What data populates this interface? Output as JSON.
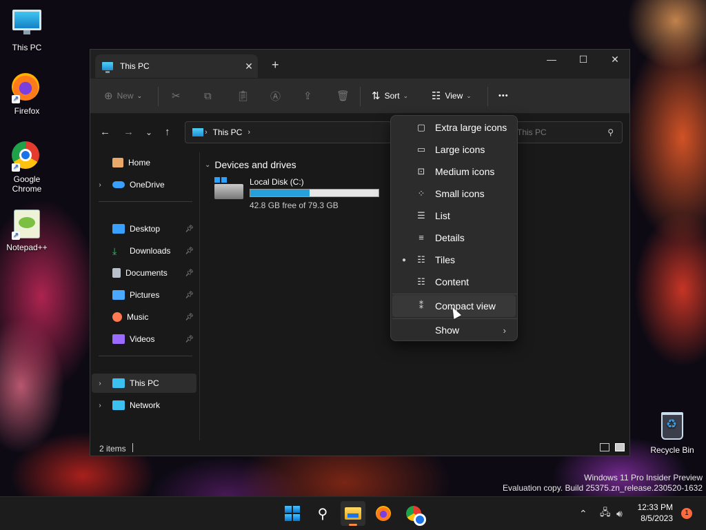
{
  "desktop": {
    "icons": [
      {
        "label": "This PC"
      },
      {
        "label": "Firefox"
      },
      {
        "label": "Google Chrome"
      },
      {
        "label": "Notepad++"
      },
      {
        "label": "Recycle Bin"
      }
    ]
  },
  "window": {
    "tab_title": "This PC",
    "new_tab_glyph": "+",
    "caption": {
      "minimize": "—",
      "maximize": "☐",
      "close": "✕"
    }
  },
  "toolbar": {
    "new_label": "New",
    "sort_label": "Sort",
    "view_label": "View",
    "more_glyph": "•••"
  },
  "address": {
    "crumb": "This PC",
    "search_placeholder": "This PC"
  },
  "sidebar": {
    "items": [
      {
        "label": "Home",
        "icon": "home-icon",
        "color": "#e8a86a"
      },
      {
        "label": "OneDrive",
        "icon": "cloud-icon",
        "color": "#3aa0ff"
      },
      {
        "label": "Desktop",
        "icon": "desktop-folder-icon",
        "color": "#3aa0ff"
      },
      {
        "label": "Downloads",
        "icon": "download-icon",
        "color": "#3cc36b"
      },
      {
        "label": "Documents",
        "icon": "document-icon",
        "color": "#b8c0cc"
      },
      {
        "label": "Pictures",
        "icon": "picture-icon",
        "color": "#4aa8ff"
      },
      {
        "label": "Music",
        "icon": "music-icon",
        "color": "#ff7a50"
      },
      {
        "label": "Videos",
        "icon": "video-icon",
        "color": "#9b6bff"
      },
      {
        "label": "This PC",
        "icon": "this-pc-icon",
        "color": "#3cc0f0"
      },
      {
        "label": "Network",
        "icon": "network-icon",
        "color": "#3cc0f0"
      }
    ]
  },
  "content": {
    "group_header": "Devices and drives",
    "drive": {
      "name": "Local Disk (C:)",
      "free_text": "42.8 GB free of 79.3 GB",
      "used_fraction": 0.46,
      "bar_color": "#26a0da"
    }
  },
  "status": {
    "items": "2 items"
  },
  "view_menu": {
    "items": [
      {
        "label": "Extra large icons",
        "icon": "extra-large-icons-icon"
      },
      {
        "label": "Large icons",
        "icon": "large-icons-icon"
      },
      {
        "label": "Medium icons",
        "icon": "medium-icons-icon"
      },
      {
        "label": "Small icons",
        "icon": "small-icons-icon"
      },
      {
        "label": "List",
        "icon": "list-icon"
      },
      {
        "label": "Details",
        "icon": "details-icon"
      },
      {
        "label": "Tiles",
        "icon": "tiles-icon",
        "selected": true
      },
      {
        "label": "Content",
        "icon": "content-icon"
      }
    ],
    "compact_view": "Compact view",
    "show": "Show"
  },
  "watermark": {
    "line1": "Windows 11 Pro Insider Preview",
    "line2": "Evaluation copy. Build 25375.zn_release.230520-1632"
  },
  "taskbar": {
    "time": "12:33 PM",
    "date": "8/5/2023",
    "notifications": "1"
  }
}
